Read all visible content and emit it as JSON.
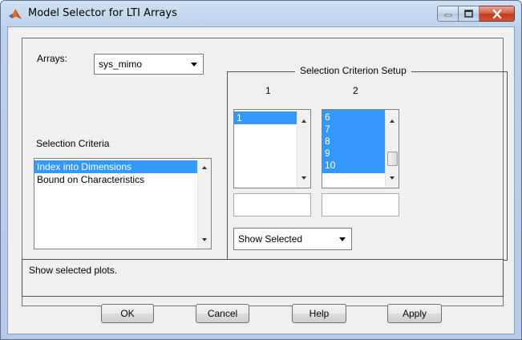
{
  "window": {
    "title": "Model Selector for LTI Arrays",
    "icon": "matlab-icon"
  },
  "arrays": {
    "label": "Arrays:",
    "selected": "sys_mimo"
  },
  "criteria": {
    "label": "Selection Criteria",
    "items": [
      "Index into Dimensions",
      "Bound on Characteristics"
    ],
    "selected_index": 0
  },
  "setup": {
    "title": "Selection Criterion Setup",
    "columns": [
      {
        "header": "1",
        "visible_items": [
          "1"
        ],
        "selected": [
          "1"
        ],
        "edit_value": ""
      },
      {
        "header": "2",
        "visible_items": [
          "6",
          "7",
          "8",
          "9",
          "10"
        ],
        "selected": [
          "6",
          "7",
          "8",
          "9",
          "10"
        ],
        "edit_value": ""
      }
    ],
    "show_mode": "Show Selected"
  },
  "status": {
    "text": "Show selected plots."
  },
  "buttons": {
    "ok": "OK",
    "cancel": "Cancel",
    "help": "Help",
    "apply": "Apply"
  },
  "colors": {
    "selection": "#3399ff",
    "close_button": "#c5391f",
    "dialog_bg": "#f0f0f0"
  }
}
